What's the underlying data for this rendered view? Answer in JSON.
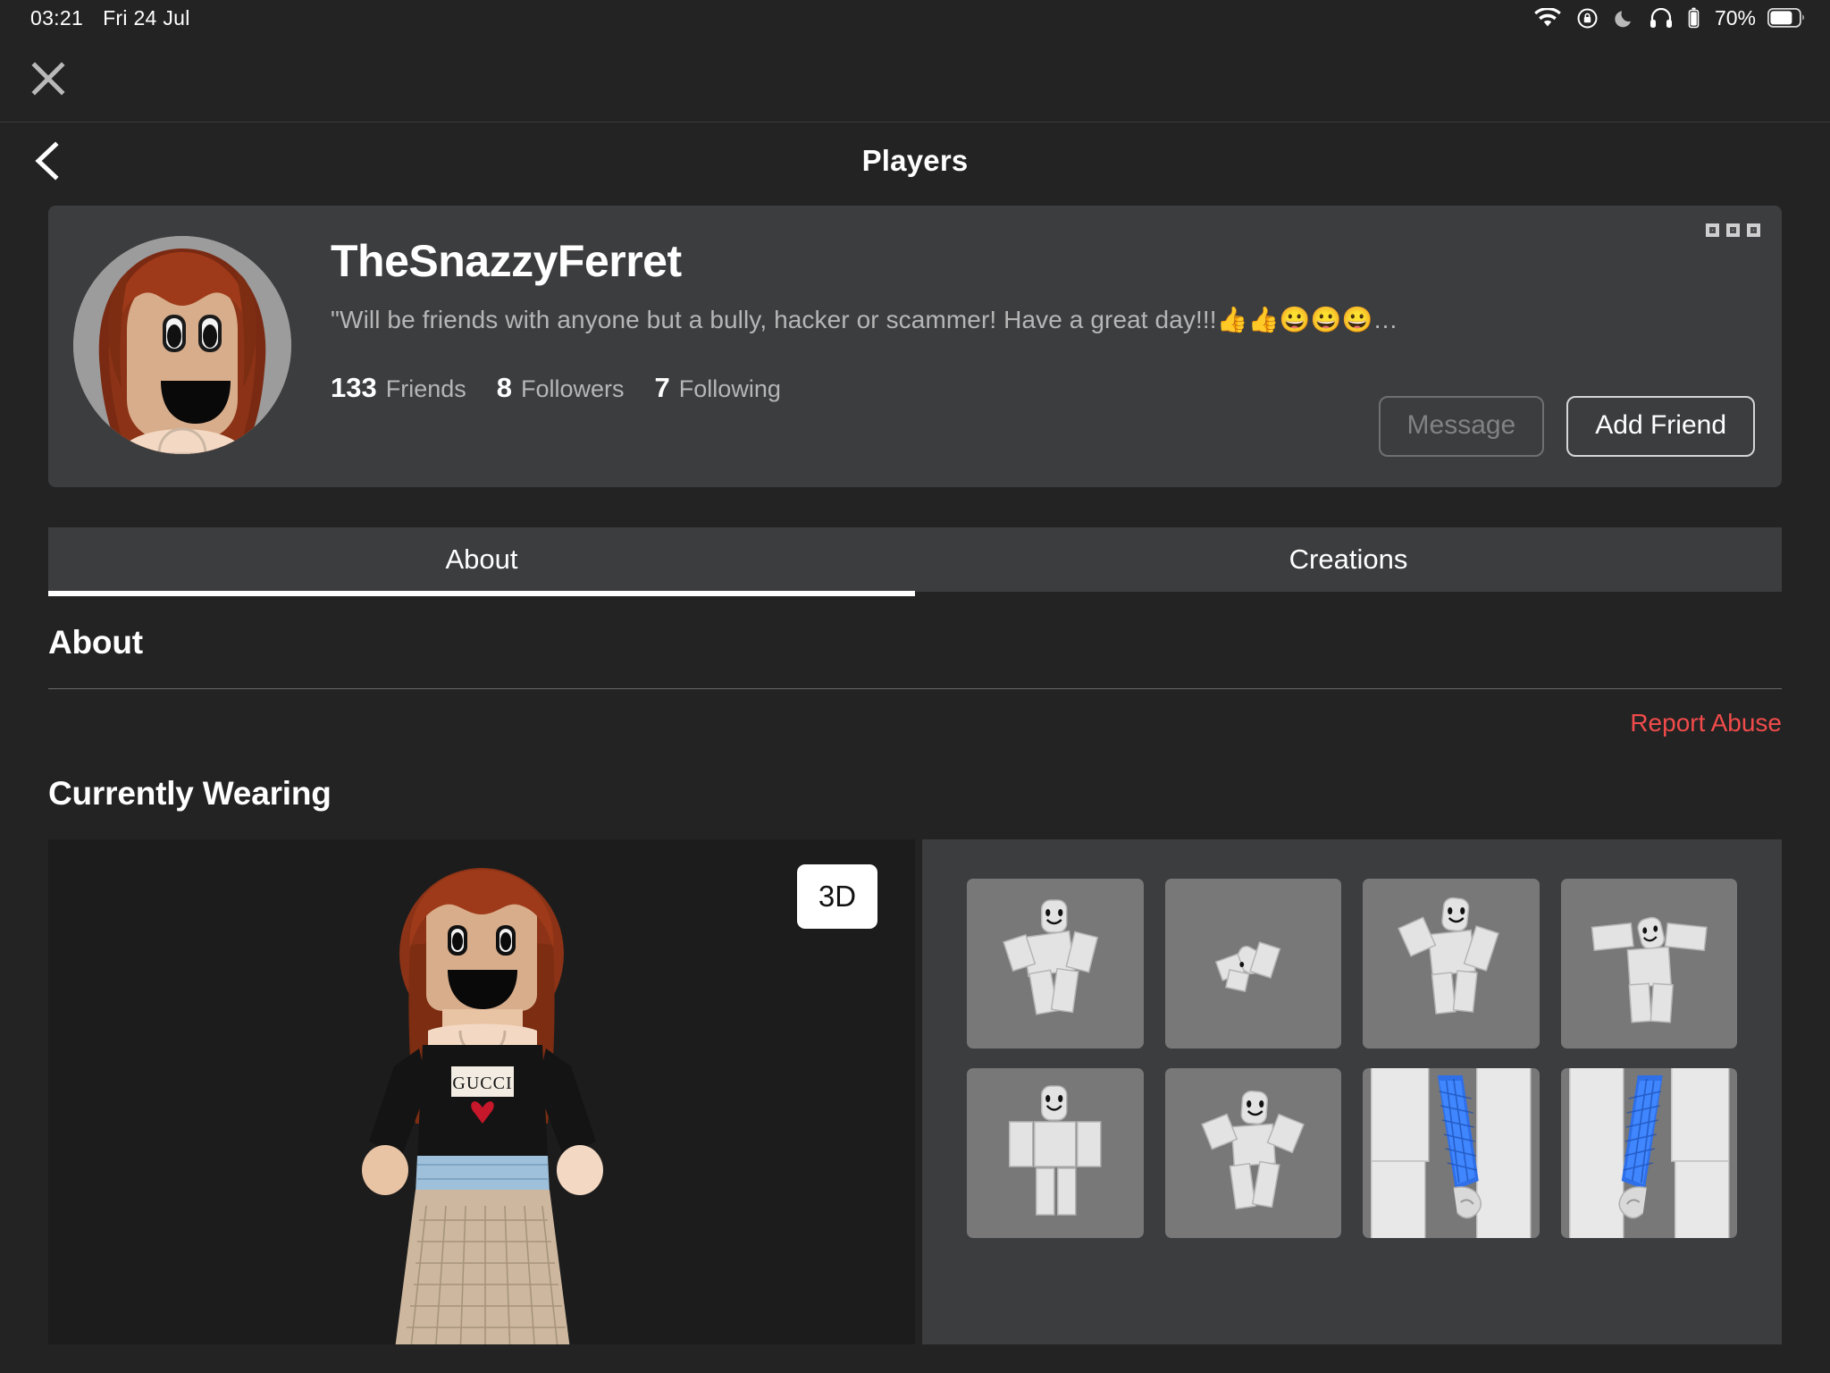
{
  "status_bar": {
    "time": "03:21",
    "date": "Fri 24 Jul",
    "battery_percent": "70%",
    "icons": [
      "wifi-icon",
      "rotation-lock-icon",
      "do-not-disturb-moon-icon",
      "headphones-icon",
      "headphones-battery-icon",
      "battery-icon"
    ]
  },
  "modal": {
    "close_label": "×"
  },
  "navbar": {
    "title": "Players",
    "back_label": "‹"
  },
  "profile": {
    "username": "TheSnazzyFerret",
    "bio": "\"Will be friends with anyone but a bully, hacker or scammer! Have a great day!!!👍👍😀😀😀…",
    "stats": [
      {
        "count": "133",
        "label": "Friends"
      },
      {
        "count": "8",
        "label": "Followers"
      },
      {
        "count": "7",
        "label": "Following"
      }
    ],
    "message_button": "Message",
    "add_friend_button": "Add Friend",
    "menu_icon": "overflow-menu-icon"
  },
  "tabs": [
    {
      "label": "About",
      "active": true
    },
    {
      "label": "Creations",
      "active": false
    }
  ],
  "about": {
    "heading": "About",
    "report_abuse": "Report Abuse",
    "report_color": "#f24b4b"
  },
  "currently_wearing": {
    "heading": "Currently Wearing",
    "viewer_toggle": "3D",
    "items": [
      {
        "name": "avatar-animation-item-1",
        "kind": "avatar"
      },
      {
        "name": "avatar-animation-item-2",
        "kind": "avatar-small"
      },
      {
        "name": "avatar-animation-item-3",
        "kind": "avatar"
      },
      {
        "name": "avatar-animation-item-4",
        "kind": "avatar"
      },
      {
        "name": "avatar-animation-item-5",
        "kind": "avatar-stand"
      },
      {
        "name": "avatar-animation-item-6",
        "kind": "avatar"
      },
      {
        "name": "blue-arm-item-7",
        "kind": "blue-arm"
      },
      {
        "name": "blue-arm-item-8",
        "kind": "blue-arm-mirror"
      }
    ]
  },
  "theme": {
    "page_bg": "#232323",
    "card_bg": "#3c3d3f",
    "viewer_bg": "#1c1c1c",
    "text_primary": "#ffffff",
    "text_secondary": "#b6b6b6"
  }
}
